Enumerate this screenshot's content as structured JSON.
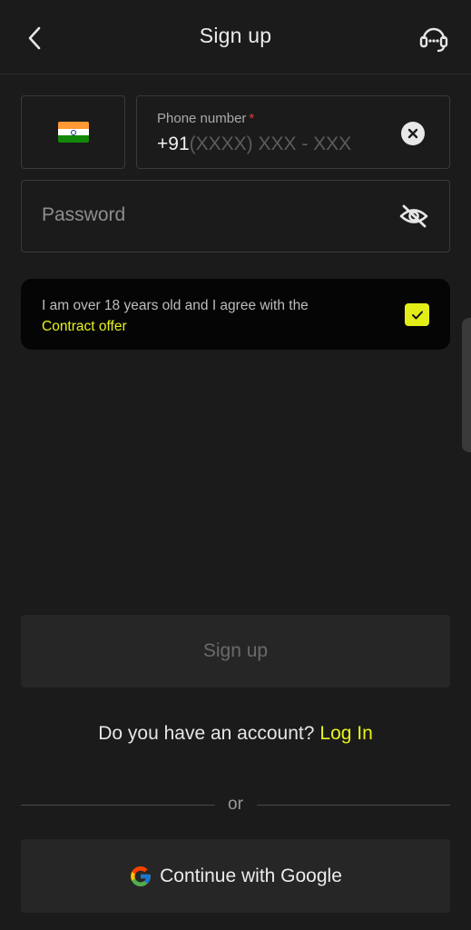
{
  "header": {
    "title": "Sign up",
    "back_icon": "chevron-left-icon",
    "support_icon": "headset-support-icon"
  },
  "country": {
    "flag": "india-flag-icon"
  },
  "phone": {
    "label": "Phone number",
    "required_mark": "*",
    "prefix": "+91",
    "placeholder": "(XXXX) XXX - XXX",
    "value": ""
  },
  "password": {
    "placeholder": "Password"
  },
  "agreement": {
    "text": "I am over 18 years old and I agree with the",
    "link": "Contract offer",
    "checked": true
  },
  "signup_button": "Sign up",
  "account": {
    "question": "Do you have an account?",
    "login": "Log In"
  },
  "divider": "or",
  "google_button": "Continue with Google",
  "colors": {
    "background": "#1b1b1b",
    "accent": "#e9f31a",
    "required": "#e03a3a"
  }
}
